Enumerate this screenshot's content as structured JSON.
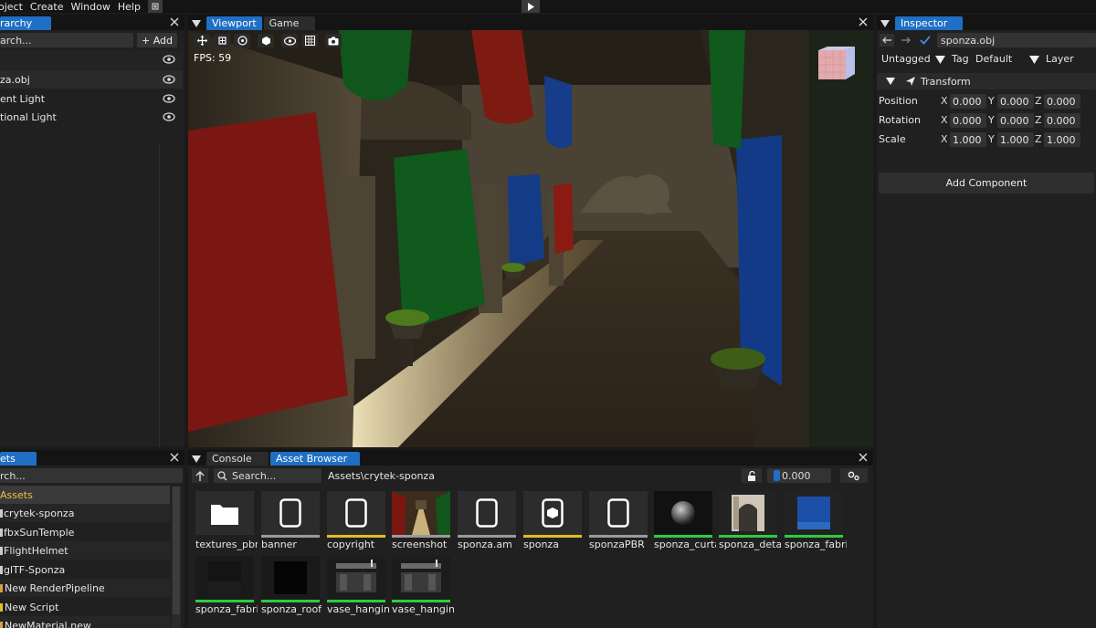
{
  "menubar": {
    "items": [
      "oject",
      "Create",
      "Window",
      "Help"
    ]
  },
  "hierarchy": {
    "tab": "rarchy",
    "search_placeholder": "arch...",
    "add_label": "+ Add",
    "items": [
      {
        "label": "za.obj"
      },
      {
        "label": "ent Light"
      },
      {
        "label": "tional Light"
      }
    ]
  },
  "viewport": {
    "tabs": [
      "Viewport",
      "Game"
    ],
    "fps": "FPS: 59"
  },
  "inspector": {
    "tab": "Inspector",
    "object_name": "sponza.obj",
    "tag_value": "Untagged",
    "tag_label": "Tag",
    "layer_value": "Default",
    "layer_label": "Layer",
    "transform_label": "Transform",
    "position": {
      "label": "Position",
      "x": "0.000",
      "y": "0.000",
      "z": "0.000"
    },
    "rotation": {
      "label": "Rotation",
      "x": "0.000",
      "y": "0.000",
      "z": "0.000"
    },
    "scale": {
      "label": "Scale",
      "x": "1.000",
      "y": "1.000",
      "z": "1.000"
    },
    "axis_x": "X",
    "axis_y": "Y",
    "axis_z": "Z",
    "add_component": "Add Component"
  },
  "assets_panel": {
    "tab": "ets",
    "search_placeholder": "rch...",
    "items": [
      {
        "label": "Assets",
        "highlight": true
      },
      {
        "label": "crytek-sponza"
      },
      {
        "label": "fbxSunTemple"
      },
      {
        "label": "FlightHelmet"
      },
      {
        "label": "glTF-Sponza"
      },
      {
        "label": "New RenderPipeline"
      },
      {
        "label": "New Script"
      },
      {
        "label": "NewMaterial.new"
      }
    ]
  },
  "bottom": {
    "tabs": [
      "Console",
      "Asset Browser"
    ],
    "search_placeholder": "Search...",
    "path": "Assets\\crytek-sponza",
    "slider_value": "0.000"
  },
  "asset_browser": {
    "items": [
      {
        "label": "textures_pbr",
        "kind": "folder",
        "bar": ""
      },
      {
        "label": "banner",
        "kind": "file",
        "bar": "#9a9a9a"
      },
      {
        "label": "copyright",
        "kind": "file",
        "bar": "#e0c020"
      },
      {
        "label": "screenshot",
        "kind": "image",
        "bar": "#9a9a9a"
      },
      {
        "label": "sponza.am",
        "kind": "file",
        "bar": "#9a9a9a"
      },
      {
        "label": "sponza",
        "kind": "mesh",
        "bar": "#e0c020"
      },
      {
        "label": "sponzaPBR",
        "kind": "file",
        "bar": "#9a9a9a"
      },
      {
        "label": "sponza_curta",
        "kind": "sphere",
        "bar": "#2ecc40"
      },
      {
        "label": "sponza_deta",
        "kind": "arch",
        "bar": "#2ecc40"
      },
      {
        "label": "sponza_fabri",
        "kind": "blue",
        "bar": "#2ecc40"
      },
      {
        "label": "sponza_fabri",
        "kind": "dark",
        "bar": "#2ecc40"
      },
      {
        "label": "sponza_roof",
        "kind": "black",
        "bar": "#2ecc40"
      },
      {
        "label": "vase_hangin",
        "kind": "vase",
        "bar": "#2ecc40"
      },
      {
        "label": "vase_hangin",
        "kind": "vase",
        "bar": "#2ecc40"
      }
    ]
  },
  "colors": {
    "accent": "#1f6fc4",
    "panel": "#202020",
    "bar": "#141414"
  }
}
